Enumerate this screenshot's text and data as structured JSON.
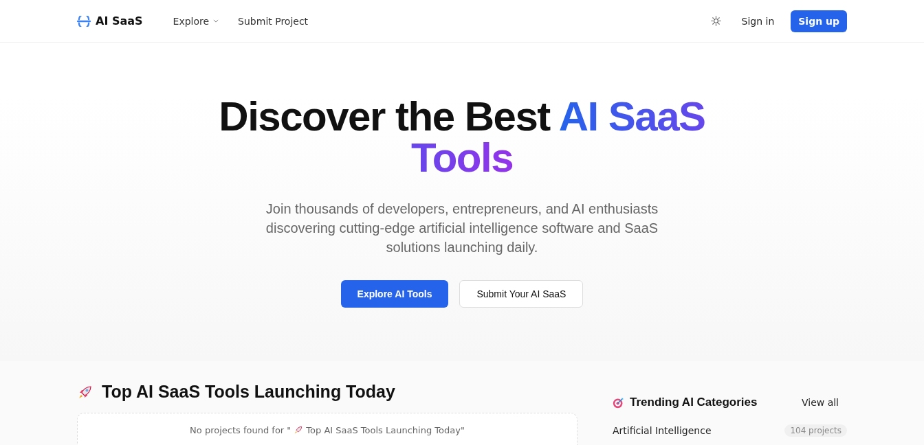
{
  "nav": {
    "brand": "AI SaaS",
    "links": [
      {
        "label": "Explore",
        "dropdown": true
      },
      {
        "label": "Submit Project",
        "dropdown": false
      }
    ],
    "sign_in": "Sign in",
    "sign_up": "Sign up"
  },
  "hero": {
    "title": "Discover the Best",
    "title_highlight": "AI SaaS Tools",
    "subtitle": "Join thousands of developers, entrepreneurs, and AI enthusiasts discovering cutting-edge artificial intelligence software and SaaS solutions launching daily.",
    "primary_button": "Explore AI Tools",
    "secondary_button": "Submit Your AI SaaS"
  },
  "today": {
    "title": "Top AI SaaS Tools Launching Today",
    "empty_prefix": "No projects found for \"",
    "empty_title": "Top AI SaaS Tools Launching Today\""
  },
  "trending": {
    "title": "Trending AI Categories",
    "view_all": "View all",
    "categories": [
      {
        "name": "Artificial Intelligence",
        "count": "104 projects"
      }
    ]
  }
}
